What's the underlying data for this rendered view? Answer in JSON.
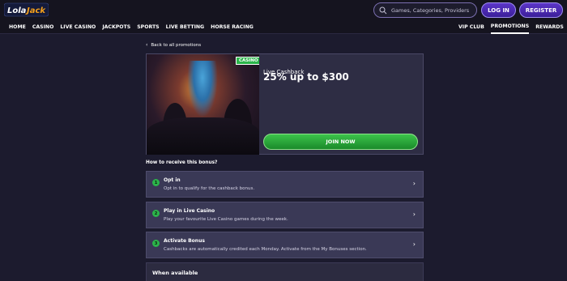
{
  "brand": {
    "logo_text": "LolaJack"
  },
  "search": {
    "placeholder": "Games, Categories, Providers"
  },
  "auth": {
    "login_label": "LOG IN",
    "register_label": "REGISTER"
  },
  "nav": {
    "left": [
      "HOME",
      "CASINO",
      "LIVE CASINO",
      "JACKPOTS",
      "SPORTS",
      "LIVE BETTING",
      "HORSE RACING"
    ],
    "right": [
      "VIP CLUB",
      "PROMOTIONS",
      "REWARDS"
    ],
    "active": "PROMOTIONS"
  },
  "promo": {
    "back_label": "Back to all promotions",
    "badge": "CASINO",
    "subtitle": "Live Cashback",
    "title": "25% up to $300",
    "cta": "JOIN NOW"
  },
  "how_to": {
    "heading": "How to receive this bonus?",
    "steps": [
      {
        "num": "1",
        "title": "Opt in",
        "desc": "Opt in to qualify for the cashback bonus."
      },
      {
        "num": "2",
        "title": "Play in Live Casino",
        "desc": "Play your favourite Live Casino games during the week."
      },
      {
        "num": "3",
        "title": "Activate Bonus",
        "desc": "Cashbacks are automatically credited each Monday. Activate from the My Bonuses section."
      }
    ]
  },
  "when": {
    "title": "When available"
  },
  "colors": {
    "accent": "#5c36c8",
    "cta_green": "#2bb54a",
    "background": "#1c1b2e"
  },
  "icons": {
    "search": "search-icon",
    "back": "chevron-left-icon",
    "step_arrow": "chevron-right-icon",
    "flag": "canada-flag-icon"
  }
}
